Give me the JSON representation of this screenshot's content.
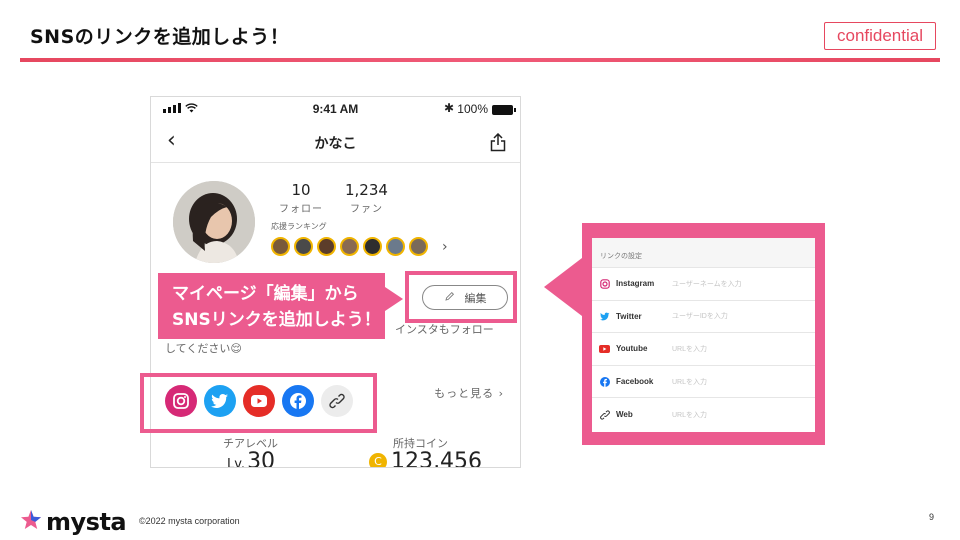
{
  "slide": {
    "title": "SNSのリンクを追加しよう！",
    "badge": "confidential",
    "page_number": "9",
    "accent_color": "#ec5b8f"
  },
  "phone": {
    "status": {
      "time": "9:41 AM",
      "battery": "100%"
    },
    "nav": {
      "title": "かなこ",
      "back_icon": "chevron-left-icon",
      "share_icon": "share-icon"
    },
    "profile": {
      "follow_count": "10",
      "follow_label": "フォロー",
      "fan_count": "1,234",
      "fan_label": "ファン",
      "ranking_label": "応援ランキング",
      "ranking_more": "›"
    },
    "edit_button": "編集",
    "bio_tail": "インスタもフォロー",
    "bio_line2": "してください😌",
    "more_link": "もっと見る ›",
    "cheer_label": "チアレベル",
    "cheer_prefix": "Lv.",
    "cheer_value": "30",
    "coin_label": "所持コイン",
    "coin_value": "123,456"
  },
  "callout": {
    "line1": "マイページ「編集」から",
    "line2": "SNSリンクを追加しよう！"
  },
  "link_settings": {
    "header": "リンクの設定",
    "rows": [
      {
        "name": "Instagram",
        "placeholder": "ユーザーネームを入力",
        "icon": "instagram-icon",
        "color": "#d62976"
      },
      {
        "name": "Twitter",
        "placeholder": "ユーザーIDを入力",
        "icon": "twitter-icon",
        "color": "#1da1f2"
      },
      {
        "name": "Youtube",
        "placeholder": "URLを入力",
        "icon": "youtube-icon",
        "color": "#e52d27"
      },
      {
        "name": "Facebook",
        "placeholder": "URLを入力",
        "icon": "facebook-icon",
        "color": "#1877f2"
      },
      {
        "name": "Web",
        "placeholder": "URLを入力",
        "icon": "link-icon",
        "color": "#333333"
      }
    ]
  },
  "footer": {
    "logo_text": "mysta",
    "copyright": "©2022 mysta corporation"
  }
}
